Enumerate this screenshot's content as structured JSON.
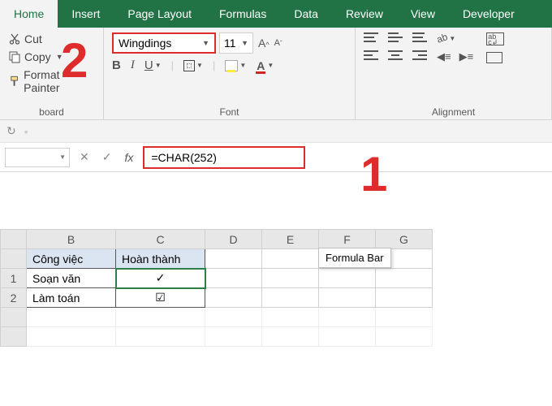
{
  "tabs": {
    "home": "Home",
    "insert": "Insert",
    "page_layout": "Page Layout",
    "formulas": "Formulas",
    "data": "Data",
    "review": "Review",
    "view": "View",
    "developer": "Developer"
  },
  "clipboard": {
    "cut": "Cut",
    "copy": "Copy",
    "format_painter": "Format Painter",
    "group": "board"
  },
  "font": {
    "name": "Wingdings",
    "size": "11",
    "b": "B",
    "i": "I",
    "u": "U",
    "a": "A",
    "group": "Font"
  },
  "alignment": {
    "group": "Alignment",
    "ab": "ab",
    "wr": "W"
  },
  "formula_bar": {
    "fx": "fx",
    "value": "=CHAR(252)"
  },
  "tooltip": "Formula Bar",
  "annotations": {
    "one": "1",
    "two": "2"
  },
  "columns": [
    "B",
    "C",
    "D",
    "E",
    "F",
    "G"
  ],
  "table": {
    "headers": {
      "b": "Công việc",
      "c": "Hoàn thành"
    },
    "rows": [
      {
        "num": "1",
        "b": "Soạn văn",
        "c": "✓"
      },
      {
        "num": "2",
        "b": "Làm toán",
        "c": "☑"
      }
    ]
  }
}
